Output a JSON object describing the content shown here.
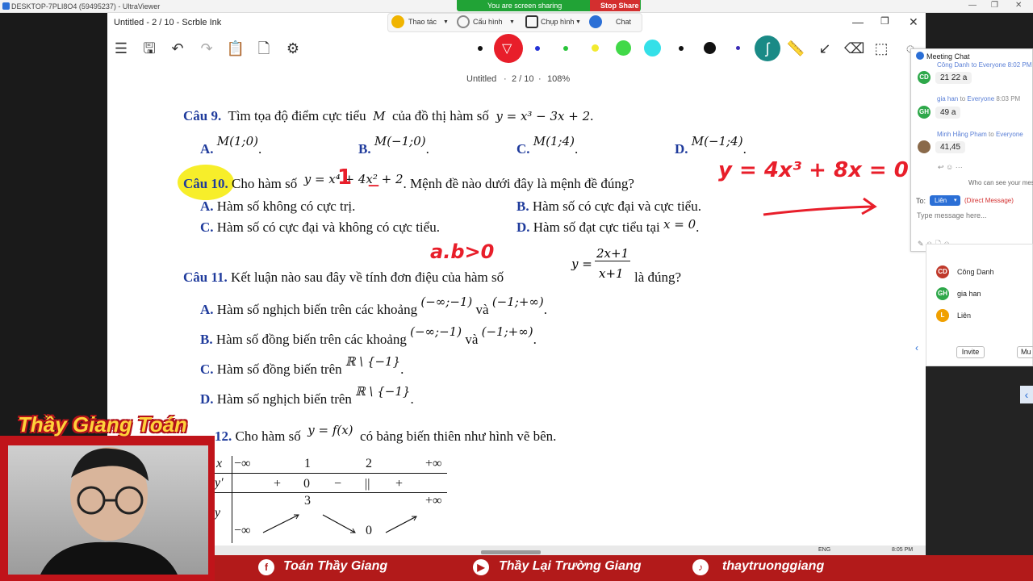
{
  "uv": {
    "title": "DESKTOP-7PLI8O4 (59495237) - UltraViewer"
  },
  "sharing": {
    "status": "You are screen sharing",
    "stop": "Stop Share"
  },
  "zoom_tools": {
    "thao_tac": "Thao tác",
    "cau_hinh": "Cấu hình",
    "chup_hinh": "Chụp hình",
    "chat": "Chat"
  },
  "ink": {
    "title": "Untitled - 2 / 10 - Scrble Ink",
    "doc_name": "Untitled",
    "page": "2 / 10",
    "zoom": "108%"
  },
  "colors": {
    "accent": "#e81e2a",
    "question_blue": "#1f3b9c",
    "highlight": "#f7ee2a",
    "banner": "#b21a1a",
    "pen_palette": [
      "#111111",
      "#e81e2a",
      "#2433d6",
      "#29c43a",
      "#f2ea2f",
      "#41d948",
      "#34e0e8",
      "#111111",
      "#111111",
      "#3b2bb5"
    ]
  },
  "q9": {
    "num": "Câu 9.",
    "text": "Tìm tọa độ điểm cực tiểu",
    "var": "M",
    "text2": "của đồ thị hàm số",
    "fn": "y = x³ − 3x + 2",
    "options": [
      {
        "k": "A.",
        "v": "M(1;0)"
      },
      {
        "k": "B.",
        "v": "M(−1;0)"
      },
      {
        "k": "C.",
        "v": "M(1;4)"
      },
      {
        "k": "D.",
        "v": "M(−1;4)"
      }
    ]
  },
  "q10": {
    "num": "Câu 10.",
    "text": "Cho hàm số",
    "fn": "y = x⁴ + 4x² + 2",
    "text2": ". Mệnh đề nào dưới đây là mệnh đề đúng?",
    "A": "Hàm số không có cực trị.",
    "B": "Hàm số có cực đại và cực tiểu.",
    "C": "Hàm số có cực đại và không có cực tiểu.",
    "D": "Hàm số đạt cực tiểu tại",
    "D_math": "x = 0",
    "lA": "A.",
    "lB": "B.",
    "lC": "C.",
    "lD": "D."
  },
  "q11": {
    "num": "Câu 11.",
    "text": "Kết luận nào sau đây về tính đơn điệu của hàm số",
    "fn_num": "2x+1",
    "fn_den": "x+1",
    "fn_y": "y =",
    "text2": "là đúng?",
    "A": "Hàm số nghịch biến trên các khoảng",
    "B": "Hàm số đồng biến trên các khoảng",
    "C": "Hàm số đồng biến trên",
    "D": "Hàm số nghịch biến trên",
    "i1": "(−∞;−1)",
    "i2": "(−1;+∞)",
    "va": "và",
    "set": "ℝ \\ {−1}",
    "lA": "A.",
    "lB": "B.",
    "lC": "C.",
    "lD": "D."
  },
  "q12": {
    "num": "12.",
    "text": "Cho hàm số",
    "fn": "y = f(x)",
    "text2": "có bảng biến thiên như hình vẽ bên."
  },
  "vtable": {
    "x": "x",
    "yp": "y′",
    "y": "y",
    "xs": [
      "−∞",
      "1",
      "2",
      "+∞"
    ],
    "signs": [
      "+",
      "0",
      "−",
      "||",
      "+"
    ],
    "ys": [
      "3",
      "+∞",
      "−∞",
      "0"
    ]
  },
  "annotations": {
    "eq": "y = 4x³ + 8x = 0",
    "ab": "a.b>0",
    "one": "1",
    "dash": "—"
  },
  "chat": {
    "title": "Meeting Chat",
    "top_partial": "Công Danh to Everyone 8:02 PM",
    "msgs": [
      {
        "initials": "CD",
        "sender": "",
        "bubble": "21 22 a",
        "color": "#2ea84a"
      },
      {
        "initials": "GH",
        "sender": "gia han",
        "to": "to",
        "rcpt": "Everyone",
        "time": "8:03 PM",
        "bubble": "49 a",
        "color": "#2ea84a"
      },
      {
        "initials": "",
        "sender": "Minh Hằng Pham",
        "to": "to",
        "rcpt": "Everyone",
        "time": "",
        "bubble": "41,45",
        "color": "#8a6a4a"
      }
    ],
    "who": "Who can see your messages?",
    "to_label": "To:",
    "to_value": "Liên",
    "direct": "(Direct Message)",
    "placeholder": "Type message here..."
  },
  "participants": [
    {
      "i": "CD",
      "n": "Công Danh",
      "c": "#c0392b"
    },
    {
      "i": "GH",
      "n": "gia han",
      "c": "#2ea84a"
    },
    {
      "i": "L",
      "n": "Liên",
      "c": "#f0a000"
    }
  ],
  "plist_buttons": {
    "invite": "Invite",
    "mute": "Mu"
  },
  "taskbar": {
    "lang": "ENG",
    "time": "8:05 PM"
  },
  "banner": {
    "fb": "Toán Thầy Giang",
    "yt": "Thầy Lại Trường Giang",
    "tt": "thaytruonggiang"
  },
  "cam": {
    "name": "Thầy Giang Toán"
  }
}
